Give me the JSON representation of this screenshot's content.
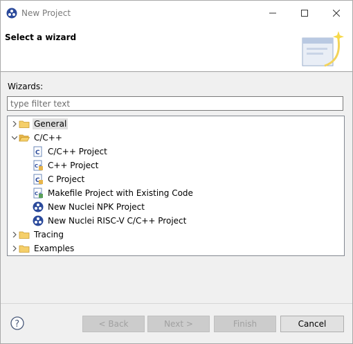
{
  "window": {
    "title": "New Project"
  },
  "header": {
    "title": "Select a wizard"
  },
  "wizards_label": "Wizards:",
  "filter": {
    "placeholder": "type filter text",
    "value": ""
  },
  "tree": [
    {
      "label": "General",
      "icon": "folder-icon",
      "expanded": false,
      "selected": true,
      "level": 0
    },
    {
      "label": "C/C++",
      "icon": "folder-icon",
      "expanded": true,
      "selected": false,
      "level": 0
    },
    {
      "label": "C/C++ Project",
      "icon": "c-project-icon",
      "level": 1
    },
    {
      "label": "C++ Project",
      "icon": "cpp-project-icon",
      "level": 1
    },
    {
      "label": "C Project",
      "icon": "c-project-icon",
      "level": 1
    },
    {
      "label": "Makefile Project with Existing Code",
      "icon": "makefile-project-icon",
      "level": 1
    },
    {
      "label": "New Nuclei NPK Project",
      "icon": "nuclei-icon",
      "level": 1
    },
    {
      "label": "New Nuclei RISC-V C/C++ Project",
      "icon": "nuclei-icon",
      "level": 1
    },
    {
      "label": "Tracing",
      "icon": "folder-icon",
      "expanded": false,
      "level": 0
    },
    {
      "label": "Examples",
      "icon": "folder-icon",
      "expanded": false,
      "level": 0
    }
  ],
  "buttons": {
    "back": "< Back",
    "next": "Next >",
    "finish": "Finish",
    "cancel": "Cancel"
  },
  "colors": {
    "accent": "#2b4a9b",
    "folder": "#e8b64c",
    "selection": "#e0e0e0"
  }
}
